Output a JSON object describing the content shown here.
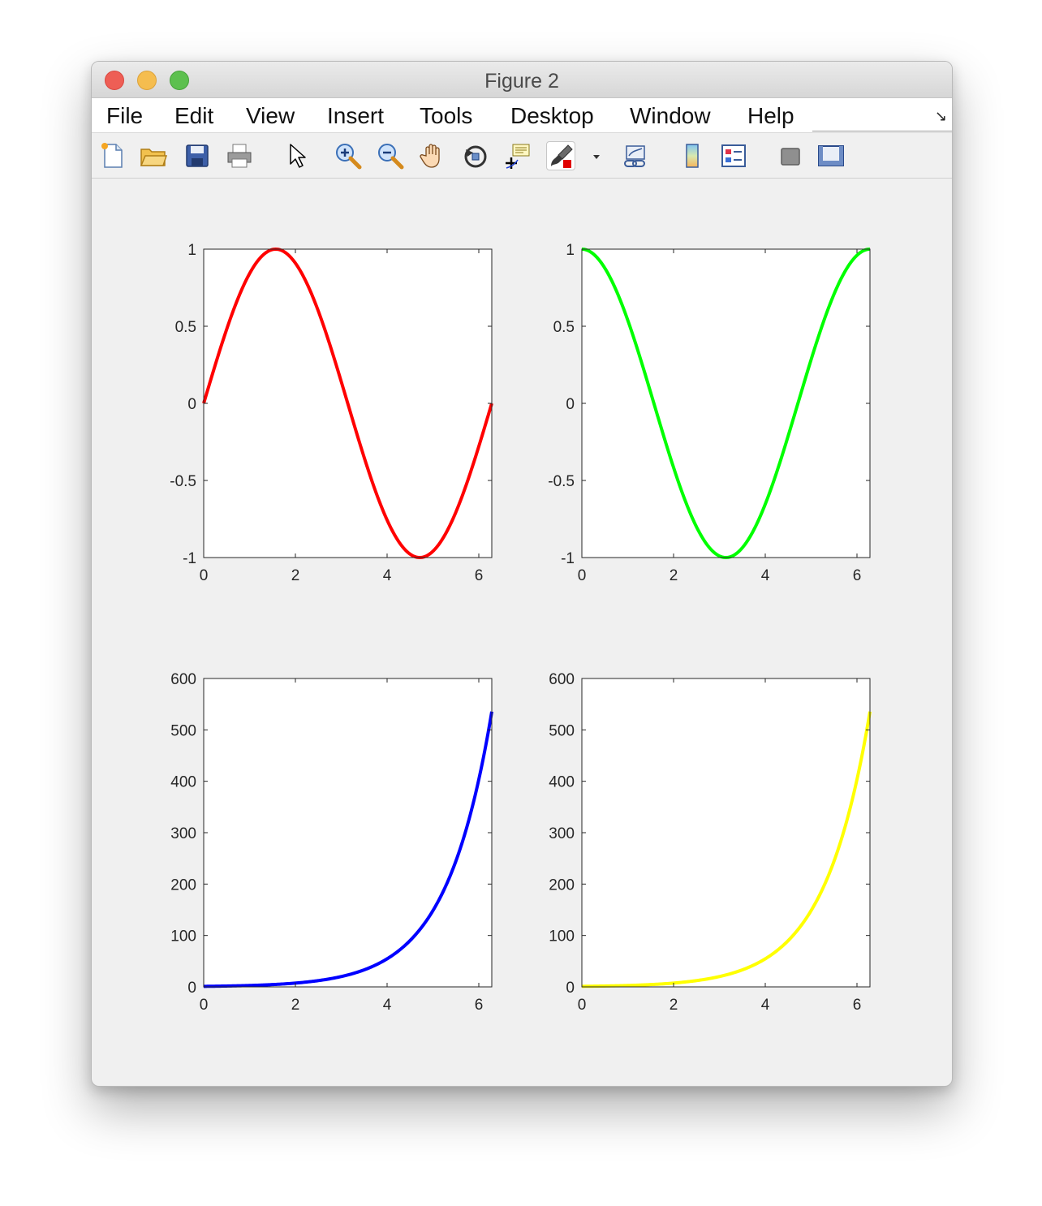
{
  "window": {
    "title": "Figure 2"
  },
  "menu": {
    "items": [
      "File",
      "Edit",
      "View",
      "Insert",
      "Tools",
      "Desktop",
      "Window",
      "Help"
    ]
  },
  "toolbar": {
    "icons": [
      "new-figure-icon",
      "open-file-icon",
      "save-icon",
      "print-icon",
      "edit-plot-pointer-icon",
      "zoom-in-icon",
      "zoom-out-icon",
      "pan-hand-icon",
      "rotate-3d-icon",
      "data-cursor-icon",
      "brush-icon",
      "brush-dropdown-icon",
      "link-plot-icon",
      "insert-colorbar-icon",
      "insert-legend-icon",
      "hide-plot-tools-icon",
      "show-plot-tools-icon"
    ]
  },
  "chart_data": [
    {
      "type": "line",
      "function": "sin(x)",
      "x_range": [
        0,
        6.2832
      ],
      "xlim": [
        0,
        6.2832
      ],
      "ylim": [
        -1,
        1
      ],
      "xticks": [
        0,
        2,
        4,
        6
      ],
      "xtick_labels": [
        "0",
        "2",
        "4",
        "6"
      ],
      "yticks": [
        -1,
        -0.5,
        0,
        0.5,
        1
      ],
      "ytick_labels": [
        "-1",
        "-0.5",
        "0",
        "0.5",
        "1"
      ],
      "color": "#ff0000",
      "title": "",
      "xlabel": "",
      "ylabel": "",
      "grid": false,
      "series": [
        {
          "x": [
            0,
            0.5236,
            1.0472,
            1.5708,
            2.0944,
            2.618,
            3.1416,
            3.6652,
            4.1888,
            4.7124,
            5.236,
            5.7596,
            6.2832
          ],
          "y": [
            0,
            0.5,
            0.866,
            1,
            0.866,
            0.5,
            0,
            -0.5,
            -0.866,
            -1,
            -0.866,
            -0.5,
            0
          ]
        }
      ]
    },
    {
      "type": "line",
      "function": "cos(x)",
      "x_range": [
        0,
        6.2832
      ],
      "xlim": [
        0,
        6.2832
      ],
      "ylim": [
        -1,
        1
      ],
      "xticks": [
        0,
        2,
        4,
        6
      ],
      "xtick_labels": [
        "0",
        "2",
        "4",
        "6"
      ],
      "yticks": [
        -1,
        -0.5,
        0,
        0.5,
        1
      ],
      "ytick_labels": [
        "-1",
        "-0.5",
        "0",
        "0.5",
        "1"
      ],
      "color": "#00ff00",
      "title": "",
      "xlabel": "",
      "ylabel": "",
      "grid": false,
      "series": [
        {
          "x": [
            0,
            0.5236,
            1.0472,
            1.5708,
            2.0944,
            2.618,
            3.1416,
            3.6652,
            4.1888,
            4.7124,
            5.236,
            5.7596,
            6.2832
          ],
          "y": [
            1,
            0.866,
            0.5,
            0,
            -0.5,
            -0.866,
            -1,
            -0.866,
            -0.5,
            0,
            0.5,
            0.866,
            1
          ]
        }
      ]
    },
    {
      "type": "line",
      "function": "exp(x)",
      "x_range": [
        0,
        6.2832
      ],
      "xlim": [
        0,
        6.2832
      ],
      "ylim": [
        0,
        600
      ],
      "xticks": [
        0,
        2,
        4,
        6
      ],
      "xtick_labels": [
        "0",
        "2",
        "4",
        "6"
      ],
      "yticks": [
        0,
        100,
        200,
        300,
        400,
        500,
        600
      ],
      "ytick_labels": [
        "0",
        "100",
        "200",
        "300",
        "400",
        "500",
        "600"
      ],
      "color": "#0000ff",
      "title": "",
      "xlabel": "",
      "ylabel": "",
      "grid": false,
      "series": [
        {
          "x": [
            0,
            1,
            2,
            3,
            4,
            4.5,
            5,
            5.5,
            6,
            6.2832
          ],
          "y": [
            1,
            2.72,
            7.39,
            20.1,
            54.6,
            90,
            148.4,
            244.7,
            403.4,
            535.5
          ]
        }
      ]
    },
    {
      "type": "line",
      "function": "exp(x)",
      "x_range": [
        0,
        6.2832
      ],
      "xlim": [
        0,
        6.2832
      ],
      "ylim": [
        0,
        600
      ],
      "xticks": [
        0,
        2,
        4,
        6
      ],
      "xtick_labels": [
        "0",
        "2",
        "4",
        "6"
      ],
      "yticks": [
        0,
        100,
        200,
        300,
        400,
        500,
        600
      ],
      "ytick_labels": [
        "0",
        "100",
        "200",
        "300",
        "400",
        "500",
        "600"
      ],
      "color": "#ffff00",
      "title": "",
      "xlabel": "",
      "ylabel": "",
      "grid": false,
      "series": [
        {
          "x": [
            0,
            1,
            2,
            3,
            4,
            4.5,
            5,
            5.5,
            6,
            6.2832
          ],
          "y": [
            1,
            2.72,
            7.39,
            20.1,
            54.6,
            90,
            148.4,
            244.7,
            403.4,
            535.5
          ]
        }
      ]
    }
  ]
}
